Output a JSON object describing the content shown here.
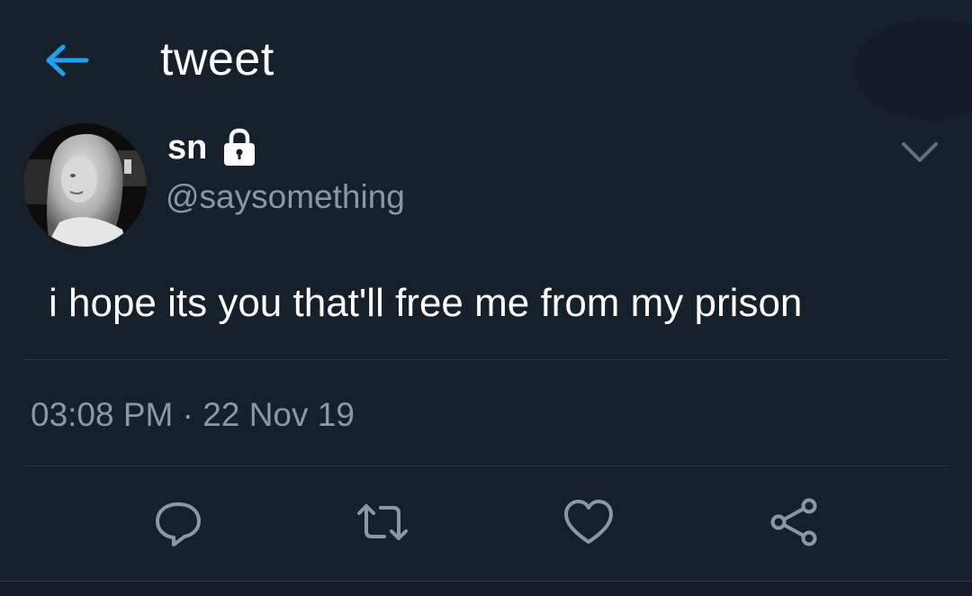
{
  "header": {
    "title": "tweet",
    "back_icon": "arrow-left-icon"
  },
  "colors": {
    "background": "#16202b",
    "accent": "#1da1f2",
    "muted": "#8899a6",
    "divider": "#2a3644",
    "text": "#ffffff"
  },
  "tweet": {
    "display_name": "sn",
    "protected_icon": "lock-icon",
    "handle": "@saysomething",
    "text": "i hope its you that'll free me from my prison",
    "time": "03:08 PM",
    "separator": "·",
    "date": "22 Nov 19",
    "menu_icon": "chevron-down-icon"
  },
  "actions": [
    {
      "name": "reply",
      "icon": "reply-icon"
    },
    {
      "name": "retweet",
      "icon": "retweet-icon"
    },
    {
      "name": "like",
      "icon": "heart-icon"
    },
    {
      "name": "share",
      "icon": "share-icon"
    }
  ]
}
